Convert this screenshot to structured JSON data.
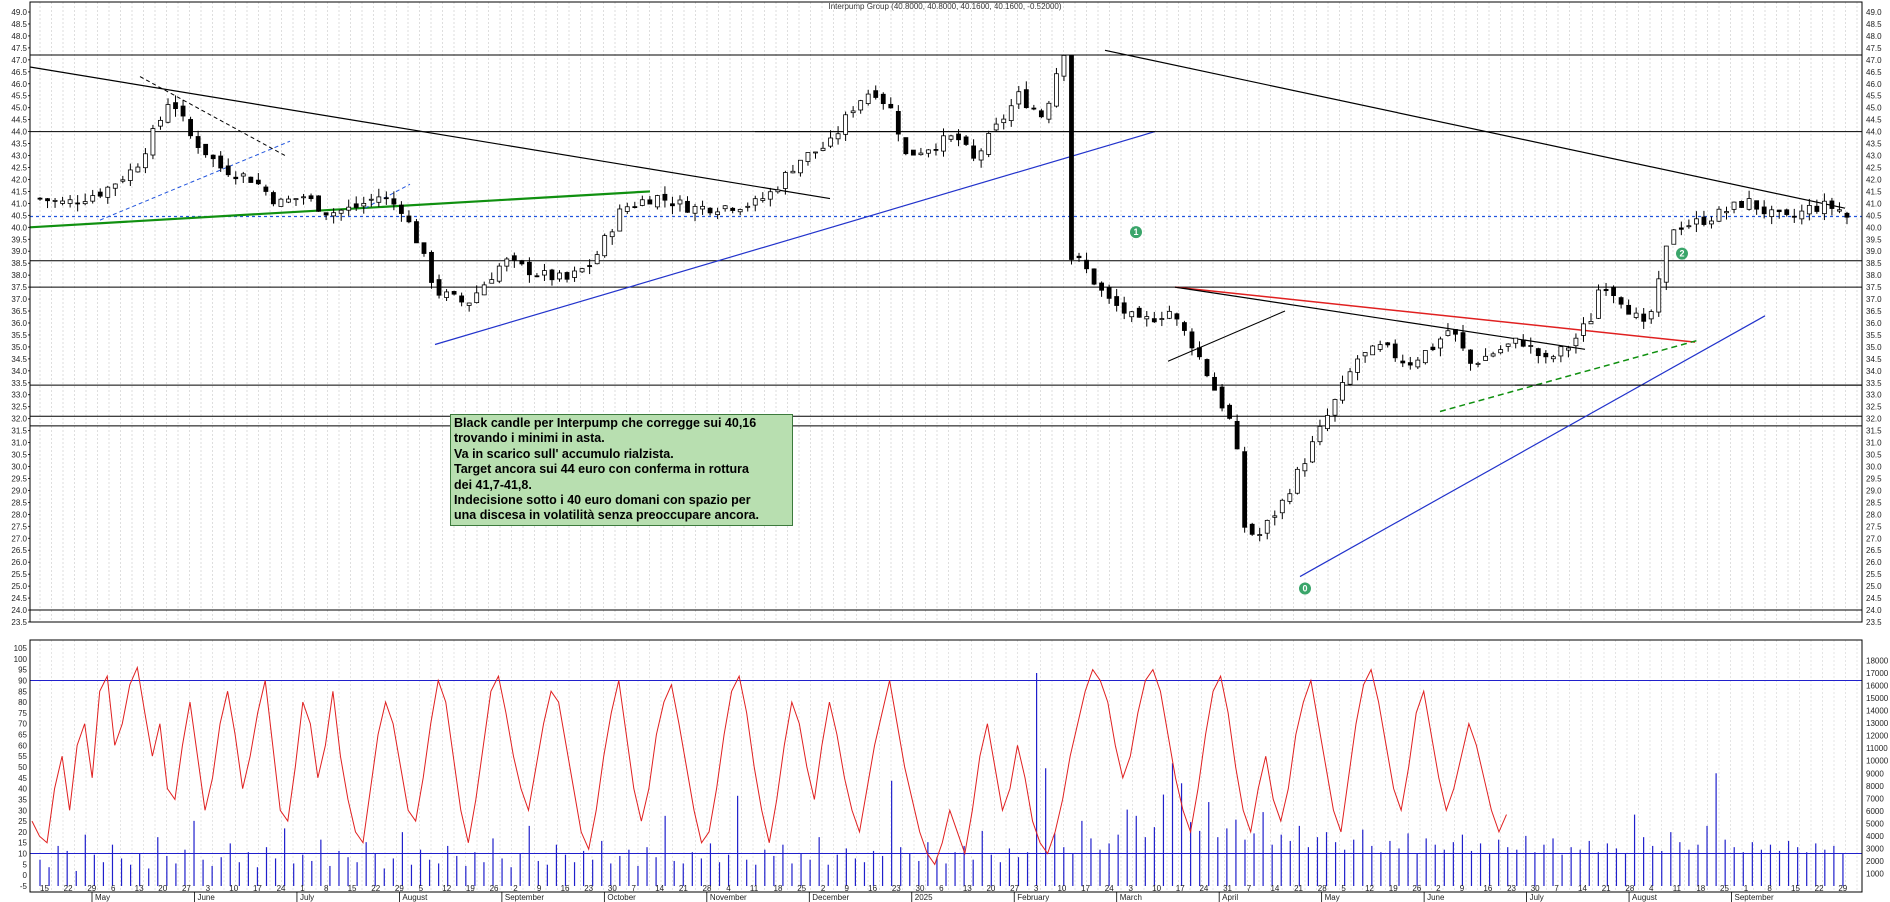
{
  "title": "Interpump Group (40.8000, 40.8000, 40.1600, 40.1600, -0.52000)",
  "annotation": {
    "lines": [
      "Black candle per Interpump che corregge sui 40,16",
      "trovando i minimi in asta.",
      "Va in scarico sull' accumulo rialzista.",
      "Target ancora sui 44 euro con conferma in rottura",
      "dei 41,7-41,8.",
      "Indecisione sotto i 40 euro domani con spazio per",
      "una discesa in volatilità senza preoccupare ancora."
    ]
  },
  "markers": [
    "1",
    "2",
    "0"
  ],
  "colors": {
    "candle_up": "#ffffff",
    "candle_down": "#000000",
    "oscillator": "#e02020",
    "volume": "#2020cc",
    "support_dotted": "#2255dd",
    "uptrend": "#2233cc",
    "green_line": "#109010",
    "red_line": "#e02020",
    "marker": "#3aa56a"
  },
  "chart_data": [
    {
      "type": "candlestick",
      "name": "price",
      "ylim": [
        23.5,
        49.0
      ],
      "y_ticks": [
        "49.0",
        "48.5",
        "48.0",
        "47.5",
        "47.0",
        "46.5",
        "46.0",
        "45.5",
        "45.0",
        "44.5",
        "44.0",
        "43.5",
        "43.0",
        "42.5",
        "42.0",
        "41.5",
        "41.0",
        "40.5",
        "40.0",
        "39.5",
        "39.0",
        "38.5",
        "38.0",
        "37.5",
        "37.0",
        "36.5",
        "36.0",
        "35.5",
        "35.0",
        "34.5",
        "34.0",
        "33.5",
        "33.0",
        "32.5",
        "32.0",
        "31.5",
        "31.0",
        "30.5",
        "30.0",
        "29.5",
        "29.0",
        "28.5",
        "28.0",
        "27.5",
        "27.0",
        "26.5",
        "26.0",
        "25.5",
        "25.0",
        "24.5",
        "24.0",
        "23.5"
      ],
      "close_path": [
        [
          0,
          41.2
        ],
        [
          10,
          41.0
        ],
        [
          25,
          41.5
        ],
        [
          38,
          42.5
        ],
        [
          48,
          44.5
        ],
        [
          52,
          45.5
        ],
        [
          60,
          43.8
        ],
        [
          72,
          42.5
        ],
        [
          85,
          42.0
        ],
        [
          95,
          41.0
        ],
        [
          105,
          41.3
        ],
        [
          115,
          40.6
        ],
        [
          125,
          40.8
        ],
        [
          135,
          41.3
        ],
        [
          144,
          40.8
        ],
        [
          150,
          39.5
        ],
        [
          158,
          37.3
        ],
        [
          170,
          36.8
        ],
        [
          185,
          38.6
        ],
        [
          200,
          38.0
        ],
        [
          210,
          37.8
        ],
        [
          220,
          38.5
        ],
        [
          232,
          40.8
        ],
        [
          245,
          41.3
        ],
        [
          260,
          40.8
        ],
        [
          275,
          40.9
        ],
        [
          285,
          41.0
        ],
        [
          292,
          41.5
        ],
        [
          302,
          42.8
        ],
        [
          315,
          43.5
        ],
        [
          325,
          45.2
        ],
        [
          332,
          45.8
        ],
        [
          340,
          44.8
        ],
        [
          345,
          43.0
        ],
        [
          355,
          43.4
        ],
        [
          365,
          43.8
        ],
        [
          372,
          42.8
        ],
        [
          380,
          44.0
        ],
        [
          390,
          45.5
        ],
        [
          400,
          44.6
        ],
        [
          405,
          46.5
        ],
        [
          408,
          47.4
        ],
        [
          410,
          38.8
        ],
        [
          415,
          38.5
        ],
        [
          425,
          37.0
        ],
        [
          438,
          36.0
        ],
        [
          450,
          36.5
        ],
        [
          460,
          35.0
        ],
        [
          470,
          32.8
        ],
        [
          476,
          31.5
        ],
        [
          480,
          27.5
        ],
        [
          485,
          27.0
        ],
        [
          495,
          28.5
        ],
        [
          505,
          30.5
        ],
        [
          515,
          32.5
        ],
        [
          525,
          34.5
        ],
        [
          535,
          35.0
        ],
        [
          545,
          34.3
        ],
        [
          555,
          35.0
        ],
        [
          562,
          35.8
        ],
        [
          570,
          34.3
        ],
        [
          580,
          34.8
        ],
        [
          590,
          35.3
        ],
        [
          600,
          34.4
        ],
        [
          610,
          35.1
        ],
        [
          618,
          36.2
        ],
        [
          622,
          37.8
        ],
        [
          630,
          37.0
        ],
        [
          640,
          35.7
        ],
        [
          645,
          37.6
        ],
        [
          650,
          40.0
        ],
        [
          660,
          40.2
        ],
        [
          670,
          40.6
        ],
        [
          680,
          41.1
        ],
        [
          690,
          40.5
        ],
        [
          697,
          40.3
        ],
        [
          705,
          40.8
        ],
        [
          712,
          40.9
        ],
        [
          718,
          40.7
        ],
        [
          722,
          40.16
        ]
      ],
      "vertical_grid": true,
      "support_dotted": 40.45,
      "horizontal_levels": [
        47.2,
        44.0,
        38.6,
        37.5,
        33.4,
        32.1,
        31.7,
        24.0
      ],
      "x_ticks": [
        "15",
        "22",
        "29",
        "6",
        "13",
        "20",
        "27",
        "3",
        "10",
        "17",
        "24",
        "1",
        "8",
        "15",
        "22",
        "29",
        "5",
        "12",
        "19",
        "26",
        "2",
        "9",
        "16",
        "23",
        "30",
        "7",
        "14",
        "21",
        "28",
        "4",
        "11",
        "18",
        "25",
        "2",
        "9",
        "16",
        "23",
        "30",
        "6",
        "13",
        "20",
        "27",
        "3",
        "10",
        "17",
        "24",
        "3",
        "10",
        "17",
        "24",
        "31",
        "7",
        "14",
        "21",
        "28",
        "5",
        "12",
        "19",
        "26",
        "2",
        "9",
        "16",
        "23",
        "30",
        "7",
        "14",
        "21",
        "28",
        "4",
        "11",
        "18",
        "25",
        "1",
        "8",
        "15",
        "22",
        "29"
      ],
      "months": [
        "May",
        "June",
        "July",
        "August",
        "September",
        "October",
        "November",
        "December",
        "2025",
        "February",
        "March",
        "April",
        "May",
        "June",
        "July",
        "August",
        "September"
      ]
    },
    {
      "type": "line",
      "name": "oscillator",
      "ylim": [
        0,
        105
      ],
      "y_ticks": [
        "105",
        "100",
        "95",
        "90",
        "85",
        "80",
        "75",
        "70",
        "65",
        "60",
        "55",
        "50",
        "45",
        "40",
        "35",
        "30",
        "25",
        "20",
        "15",
        "10",
        "5",
        "0",
        "-5"
      ],
      "levels": [
        90,
        10
      ],
      "values": [
        25,
        18,
        15,
        40,
        55,
        30,
        60,
        70,
        45,
        85,
        92,
        60,
        70,
        88,
        96,
        75,
        55,
        70,
        40,
        35,
        60,
        80,
        55,
        30,
        45,
        70,
        85,
        65,
        40,
        55,
        75,
        90,
        60,
        30,
        25,
        50,
        80,
        70,
        45,
        60,
        85,
        55,
        35,
        20,
        15,
        40,
        65,
        80,
        70,
        50,
        30,
        25,
        45,
        70,
        90,
        80,
        55,
        30,
        15,
        35,
        60,
        85,
        92,
        75,
        55,
        40,
        30,
        50,
        70,
        85,
        80,
        60,
        40,
        20,
        12,
        30,
        55,
        75,
        90,
        65,
        40,
        25,
        40,
        65,
        80,
        88,
        70,
        50,
        30,
        15,
        20,
        40,
        65,
        85,
        92,
        75,
        50,
        30,
        15,
        35,
        60,
        80,
        70,
        50,
        35,
        60,
        80,
        65,
        45,
        30,
        20,
        40,
        60,
        75,
        90,
        70,
        50,
        35,
        20,
        10,
        5,
        15,
        30,
        20,
        10,
        30,
        55,
        70,
        50,
        30,
        40,
        60,
        45,
        25,
        15,
        10,
        20,
        35,
        55,
        70,
        85,
        95,
        90,
        80,
        60,
        45,
        55,
        75,
        90,
        95,
        85,
        65,
        45,
        30,
        20,
        40,
        65,
        85,
        92,
        75,
        50,
        30,
        20,
        40,
        55,
        35,
        25,
        40,
        65,
        80,
        90,
        70,
        50,
        30,
        20,
        45,
        70,
        88,
        95,
        80,
        60,
        40,
        30,
        50,
        75,
        85,
        65,
        45,
        30,
        40,
        55,
        70,
        60,
        45,
        30,
        20,
        28
      ]
    },
    {
      "type": "bar",
      "name": "volume",
      "ylim": [
        0,
        19000
      ],
      "y_ticks": [
        "18000",
        "17000",
        "16000",
        "15000",
        "14000",
        "13000",
        "12000",
        "11000",
        "10000",
        "9000",
        "8000",
        "7000",
        "6000",
        "5000",
        "4000",
        "3000",
        "2000",
        "1000"
      ],
      "values": [
        2100,
        1500,
        3200,
        2800,
        1200,
        4100,
        2500,
        1900,
        3300,
        2200,
        1700,
        2600,
        1400,
        3900,
        2400,
        1800,
        2900,
        5200,
        2100,
        1600,
        2300,
        3400,
        1900,
        2700,
        1500,
        3100,
        2200,
        4600,
        1800,
        2500,
        2000,
        3700,
        1600,
        2800,
        2300,
        1900,
        3500,
        2600,
        1400,
        2200,
        4300,
        1700,
        2900,
        2100,
        1800,
        3200,
        2400,
        1600,
        2700,
        1900,
        3800,
        2200,
        1500,
        2600,
        4800,
        2000,
        1700,
        3300,
        2500,
        1900,
        2800,
        2100,
        3600,
        1800,
        2400,
        2900,
        1600,
        3100,
        2300,
        5600,
        2000,
        1800,
        2700,
        2200,
        3400,
        1900,
        2500,
        7200,
        2100,
        1700,
        2900,
        2400,
        3300,
        1800,
        2600,
        2100,
        3900,
        1700,
        2500,
        3000,
        2200,
        1900,
        2800,
        2400,
        8400,
        3100,
        2600,
        2000,
        3500,
        2300,
        1800,
        2700,
        3200,
        2100,
        4400,
        2500,
        1900,
        3000,
        2300,
        2700,
        17000,
        9400,
        4200,
        3100,
        2600,
        5200,
        3800,
        2900,
        3400,
        4100,
        6100,
        5600,
        3900,
        4700,
        7300,
        9800,
        8200,
        5100,
        4400,
        6700,
        3900,
        4600,
        5300,
        3700,
        4200,
        5900,
        3300,
        4100,
        3600,
        4800,
        3100,
        3900,
        4300,
        3500,
        2900,
        3700,
        4500,
        3200,
        2700,
        3600,
        3000,
        4200,
        2600,
        3800,
        3300,
        2900,
        3500,
        4100,
        2800,
        3400,
        2600,
        3700,
        3100,
        2900,
        4000,
        2700,
        3300,
        3800,
        2500,
        3100,
        2900,
        3600,
        2700,
        3400,
        3000,
        2600,
        5700,
        3900,
        3200,
        2800,
        4300,
        3500,
        2900,
        3300,
        4800,
        9000,
        3700,
        3100,
        2700,
        3500,
        2900,
        3300,
        2800,
        3600,
        3100,
        2700,
        3400,
        2900,
        3200,
        2600
      ]
    }
  ]
}
